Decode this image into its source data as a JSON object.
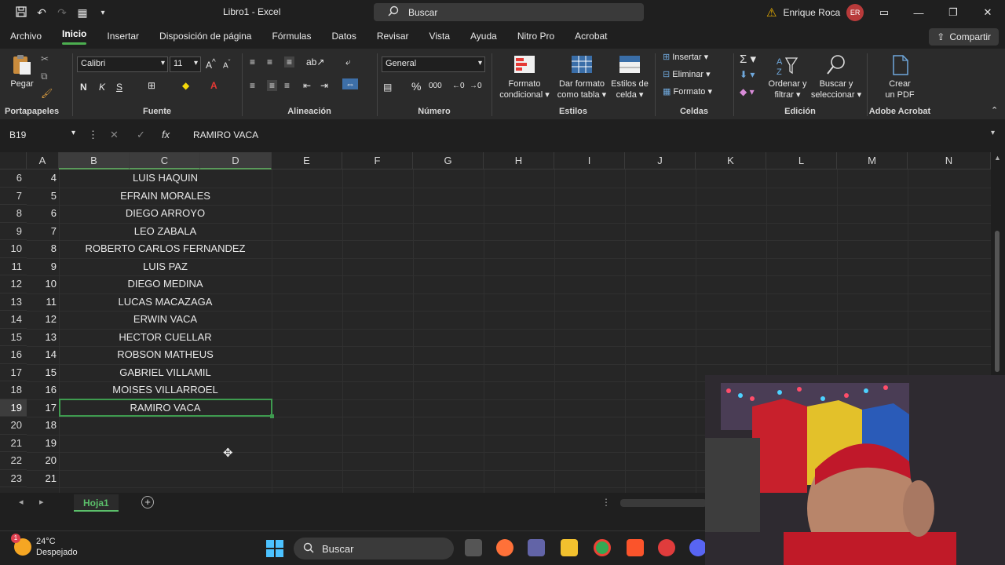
{
  "titlebar": {
    "doc_title": "Libro1 - Excel",
    "search_placeholder": "Buscar",
    "user_name": "Enrique Roca",
    "user_initials": "ER"
  },
  "menu": {
    "items": [
      "Archivo",
      "Inicio",
      "Insertar",
      "Disposición de página",
      "Fórmulas",
      "Datos",
      "Revisar",
      "Vista",
      "Ayuda",
      "Nitro Pro",
      "Acrobat"
    ],
    "active": "Inicio",
    "share": "Compartir"
  },
  "ribbon": {
    "clipboard": {
      "paste": "Pegar",
      "label": "Portapapeles"
    },
    "font": {
      "name": "Calibri",
      "size": "11",
      "label": "Fuente",
      "bold": "N",
      "italic": "K",
      "underline": "S"
    },
    "alignment": {
      "label": "Alineación"
    },
    "number": {
      "format": "General",
      "label": "Número",
      "percent": "%",
      "thousands": "000"
    },
    "styles": {
      "conditional_1": "Formato",
      "conditional_2": "condicional",
      "table_1": "Dar formato",
      "table_2": "como tabla",
      "cell_1": "Estilos de",
      "cell_2": "celda",
      "label": "Estilos"
    },
    "cells": {
      "insert": "Insertar",
      "delete": "Eliminar",
      "format": "Formato",
      "label": "Celdas"
    },
    "editing": {
      "sort_1": "Ordenar y",
      "sort_2": "filtrar",
      "find_1": "Buscar y",
      "find_2": "seleccionar",
      "label": "Edición"
    },
    "acrobat": {
      "create_1": "Crear",
      "create_2": "un PDF",
      "label": "Adobe Acrobat"
    }
  },
  "formula_bar": {
    "cell_ref": "B19",
    "content": "RAMIRO VACA"
  },
  "grid": {
    "columns": [
      "A",
      "B",
      "C",
      "D",
      "E",
      "F",
      "G",
      "H",
      "I",
      "J",
      "K",
      "L",
      "M",
      "N"
    ],
    "rows": [
      {
        "row": "6",
        "num": "4",
        "name": "LUIS HAQUIN"
      },
      {
        "row": "7",
        "num": "5",
        "name": "EFRAIN MORALES"
      },
      {
        "row": "8",
        "num": "6",
        "name": "DIEGO ARROYO"
      },
      {
        "row": "9",
        "num": "7",
        "name": "LEO ZABALA"
      },
      {
        "row": "10",
        "num": "8",
        "name": "ROBERTO CARLOS FERNANDEZ"
      },
      {
        "row": "11",
        "num": "9",
        "name": "LUIS PAZ"
      },
      {
        "row": "12",
        "num": "10",
        "name": "DIEGO MEDINA"
      },
      {
        "row": "13",
        "num": "11",
        "name": "LUCAS MACAZAGA"
      },
      {
        "row": "14",
        "num": "12",
        "name": "ERWIN VACA"
      },
      {
        "row": "15",
        "num": "13",
        "name": "HECTOR CUELLAR"
      },
      {
        "row": "16",
        "num": "14",
        "name": "ROBSON MATHEUS"
      },
      {
        "row": "17",
        "num": "15",
        "name": "GABRIEL VILLAMIL"
      },
      {
        "row": "18",
        "num": "16",
        "name": "MOISES VILLARROEL"
      },
      {
        "row": "19",
        "num": "17",
        "name": "RAMIRO VACA"
      },
      {
        "row": "20",
        "num": "18",
        "name": ""
      },
      {
        "row": "21",
        "num": "19",
        "name": ""
      },
      {
        "row": "22",
        "num": "20",
        "name": ""
      },
      {
        "row": "23",
        "num": "21",
        "name": ""
      }
    ]
  },
  "sheet": {
    "tab": "Hoja1"
  },
  "taskbar": {
    "temp": "24°C",
    "weather": "Despejado",
    "weather_badge": "1",
    "search": "Buscar"
  },
  "colors": {
    "accent": "#3e9b4f",
    "background": "#1f1f1f",
    "grid": "#262626"
  }
}
